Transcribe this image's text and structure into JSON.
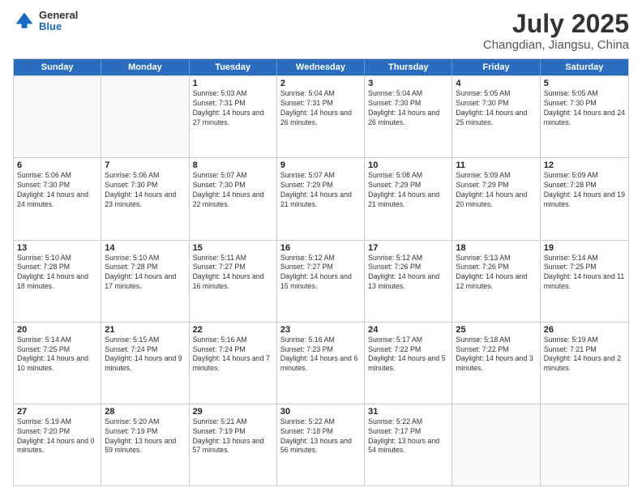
{
  "header": {
    "logo_general": "General",
    "logo_blue": "Blue",
    "month": "July 2025",
    "location": "Changdian, Jiangsu, China"
  },
  "weekdays": [
    "Sunday",
    "Monday",
    "Tuesday",
    "Wednesday",
    "Thursday",
    "Friday",
    "Saturday"
  ],
  "rows": [
    [
      {
        "day": "",
        "text": ""
      },
      {
        "day": "",
        "text": ""
      },
      {
        "day": "1",
        "text": "Sunrise: 5:03 AM\nSunset: 7:31 PM\nDaylight: 14 hours and 27 minutes."
      },
      {
        "day": "2",
        "text": "Sunrise: 5:04 AM\nSunset: 7:31 PM\nDaylight: 14 hours and 26 minutes."
      },
      {
        "day": "3",
        "text": "Sunrise: 5:04 AM\nSunset: 7:30 PM\nDaylight: 14 hours and 26 minutes."
      },
      {
        "day": "4",
        "text": "Sunrise: 5:05 AM\nSunset: 7:30 PM\nDaylight: 14 hours and 25 minutes."
      },
      {
        "day": "5",
        "text": "Sunrise: 5:05 AM\nSunset: 7:30 PM\nDaylight: 14 hours and 24 minutes."
      }
    ],
    [
      {
        "day": "6",
        "text": "Sunrise: 5:06 AM\nSunset: 7:30 PM\nDaylight: 14 hours and 24 minutes."
      },
      {
        "day": "7",
        "text": "Sunrise: 5:06 AM\nSunset: 7:30 PM\nDaylight: 14 hours and 23 minutes."
      },
      {
        "day": "8",
        "text": "Sunrise: 5:07 AM\nSunset: 7:30 PM\nDaylight: 14 hours and 22 minutes."
      },
      {
        "day": "9",
        "text": "Sunrise: 5:07 AM\nSunset: 7:29 PM\nDaylight: 14 hours and 21 minutes."
      },
      {
        "day": "10",
        "text": "Sunrise: 5:08 AM\nSunset: 7:29 PM\nDaylight: 14 hours and 21 minutes."
      },
      {
        "day": "11",
        "text": "Sunrise: 5:09 AM\nSunset: 7:29 PM\nDaylight: 14 hours and 20 minutes."
      },
      {
        "day": "12",
        "text": "Sunrise: 5:09 AM\nSunset: 7:28 PM\nDaylight: 14 hours and 19 minutes."
      }
    ],
    [
      {
        "day": "13",
        "text": "Sunrise: 5:10 AM\nSunset: 7:28 PM\nDaylight: 14 hours and 18 minutes."
      },
      {
        "day": "14",
        "text": "Sunrise: 5:10 AM\nSunset: 7:28 PM\nDaylight: 14 hours and 17 minutes."
      },
      {
        "day": "15",
        "text": "Sunrise: 5:11 AM\nSunset: 7:27 PM\nDaylight: 14 hours and 16 minutes."
      },
      {
        "day": "16",
        "text": "Sunrise: 5:12 AM\nSunset: 7:27 PM\nDaylight: 14 hours and 15 minutes."
      },
      {
        "day": "17",
        "text": "Sunrise: 5:12 AM\nSunset: 7:26 PM\nDaylight: 14 hours and 13 minutes."
      },
      {
        "day": "18",
        "text": "Sunrise: 5:13 AM\nSunset: 7:26 PM\nDaylight: 14 hours and 12 minutes."
      },
      {
        "day": "19",
        "text": "Sunrise: 5:14 AM\nSunset: 7:25 PM\nDaylight: 14 hours and 11 minutes."
      }
    ],
    [
      {
        "day": "20",
        "text": "Sunrise: 5:14 AM\nSunset: 7:25 PM\nDaylight: 14 hours and 10 minutes."
      },
      {
        "day": "21",
        "text": "Sunrise: 5:15 AM\nSunset: 7:24 PM\nDaylight: 14 hours and 9 minutes."
      },
      {
        "day": "22",
        "text": "Sunrise: 5:16 AM\nSunset: 7:24 PM\nDaylight: 14 hours and 7 minutes."
      },
      {
        "day": "23",
        "text": "Sunrise: 5:16 AM\nSunset: 7:23 PM\nDaylight: 14 hours and 6 minutes."
      },
      {
        "day": "24",
        "text": "Sunrise: 5:17 AM\nSunset: 7:22 PM\nDaylight: 14 hours and 5 minutes."
      },
      {
        "day": "25",
        "text": "Sunrise: 5:18 AM\nSunset: 7:22 PM\nDaylight: 14 hours and 3 minutes."
      },
      {
        "day": "26",
        "text": "Sunrise: 5:19 AM\nSunset: 7:21 PM\nDaylight: 14 hours and 2 minutes."
      }
    ],
    [
      {
        "day": "27",
        "text": "Sunrise: 5:19 AM\nSunset: 7:20 PM\nDaylight: 14 hours and 0 minutes."
      },
      {
        "day": "28",
        "text": "Sunrise: 5:20 AM\nSunset: 7:19 PM\nDaylight: 13 hours and 59 minutes."
      },
      {
        "day": "29",
        "text": "Sunrise: 5:21 AM\nSunset: 7:19 PM\nDaylight: 13 hours and 57 minutes."
      },
      {
        "day": "30",
        "text": "Sunrise: 5:22 AM\nSunset: 7:18 PM\nDaylight: 13 hours and 56 minutes."
      },
      {
        "day": "31",
        "text": "Sunrise: 5:22 AM\nSunset: 7:17 PM\nDaylight: 13 hours and 54 minutes."
      },
      {
        "day": "",
        "text": ""
      },
      {
        "day": "",
        "text": ""
      }
    ]
  ]
}
